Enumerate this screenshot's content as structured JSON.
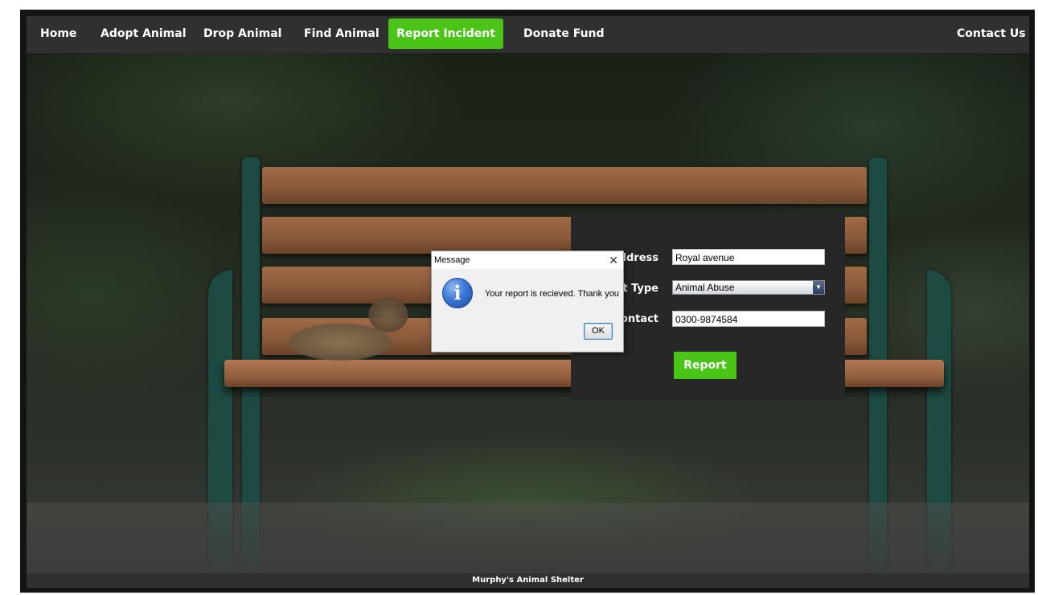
{
  "nav": {
    "items": [
      {
        "label": "Home"
      },
      {
        "label": "Adopt Animal"
      },
      {
        "label": "Drop Animal"
      },
      {
        "label": "Find Animal"
      },
      {
        "label": "Report Incident"
      },
      {
        "label": "Donate Fund"
      }
    ],
    "active": "Report Incident",
    "contact": "Contact Us"
  },
  "form": {
    "address_label": "Address",
    "address_value": "Royal avenue",
    "type_label": "ent Type",
    "type_value": "Animal Abuse",
    "contact_label": "Contact",
    "contact_value": "0300-9874584",
    "submit_label": "Report"
  },
  "dialog": {
    "title": "Message",
    "message": "Your report is recieved. Thank you",
    "ok_label": "OK",
    "close_glyph": "✕",
    "icon": "info-icon",
    "icon_glyph": "i"
  },
  "footer": {
    "text": "Murphy's Animal Shelter"
  },
  "colors": {
    "accent": "#49c417",
    "nav_bg": "#303030",
    "panel_bg": "#272727"
  }
}
